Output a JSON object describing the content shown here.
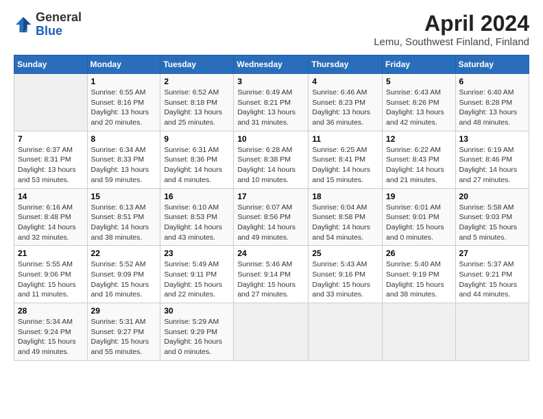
{
  "header": {
    "logo_line1": "General",
    "logo_line2": "Blue",
    "month": "April 2024",
    "location": "Lemu, Southwest Finland, Finland"
  },
  "weekdays": [
    "Sunday",
    "Monday",
    "Tuesday",
    "Wednesday",
    "Thursday",
    "Friday",
    "Saturday"
  ],
  "weeks": [
    [
      {
        "day": "",
        "info": ""
      },
      {
        "day": "1",
        "info": "Sunrise: 6:55 AM\nSunset: 8:16 PM\nDaylight: 13 hours\nand 20 minutes."
      },
      {
        "day": "2",
        "info": "Sunrise: 6:52 AM\nSunset: 8:18 PM\nDaylight: 13 hours\nand 25 minutes."
      },
      {
        "day": "3",
        "info": "Sunrise: 6:49 AM\nSunset: 8:21 PM\nDaylight: 13 hours\nand 31 minutes."
      },
      {
        "day": "4",
        "info": "Sunrise: 6:46 AM\nSunset: 8:23 PM\nDaylight: 13 hours\nand 36 minutes."
      },
      {
        "day": "5",
        "info": "Sunrise: 6:43 AM\nSunset: 8:26 PM\nDaylight: 13 hours\nand 42 minutes."
      },
      {
        "day": "6",
        "info": "Sunrise: 6:40 AM\nSunset: 8:28 PM\nDaylight: 13 hours\nand 48 minutes."
      }
    ],
    [
      {
        "day": "7",
        "info": "Sunrise: 6:37 AM\nSunset: 8:31 PM\nDaylight: 13 hours\nand 53 minutes."
      },
      {
        "day": "8",
        "info": "Sunrise: 6:34 AM\nSunset: 8:33 PM\nDaylight: 13 hours\nand 59 minutes."
      },
      {
        "day": "9",
        "info": "Sunrise: 6:31 AM\nSunset: 8:36 PM\nDaylight: 14 hours\nand 4 minutes."
      },
      {
        "day": "10",
        "info": "Sunrise: 6:28 AM\nSunset: 8:38 PM\nDaylight: 14 hours\nand 10 minutes."
      },
      {
        "day": "11",
        "info": "Sunrise: 6:25 AM\nSunset: 8:41 PM\nDaylight: 14 hours\nand 15 minutes."
      },
      {
        "day": "12",
        "info": "Sunrise: 6:22 AM\nSunset: 8:43 PM\nDaylight: 14 hours\nand 21 minutes."
      },
      {
        "day": "13",
        "info": "Sunrise: 6:19 AM\nSunset: 8:46 PM\nDaylight: 14 hours\nand 27 minutes."
      }
    ],
    [
      {
        "day": "14",
        "info": "Sunrise: 6:16 AM\nSunset: 8:48 PM\nDaylight: 14 hours\nand 32 minutes."
      },
      {
        "day": "15",
        "info": "Sunrise: 6:13 AM\nSunset: 8:51 PM\nDaylight: 14 hours\nand 38 minutes."
      },
      {
        "day": "16",
        "info": "Sunrise: 6:10 AM\nSunset: 8:53 PM\nDaylight: 14 hours\nand 43 minutes."
      },
      {
        "day": "17",
        "info": "Sunrise: 6:07 AM\nSunset: 8:56 PM\nDaylight: 14 hours\nand 49 minutes."
      },
      {
        "day": "18",
        "info": "Sunrise: 6:04 AM\nSunset: 8:58 PM\nDaylight: 14 hours\nand 54 minutes."
      },
      {
        "day": "19",
        "info": "Sunrise: 6:01 AM\nSunset: 9:01 PM\nDaylight: 15 hours\nand 0 minutes."
      },
      {
        "day": "20",
        "info": "Sunrise: 5:58 AM\nSunset: 9:03 PM\nDaylight: 15 hours\nand 5 minutes."
      }
    ],
    [
      {
        "day": "21",
        "info": "Sunrise: 5:55 AM\nSunset: 9:06 PM\nDaylight: 15 hours\nand 11 minutes."
      },
      {
        "day": "22",
        "info": "Sunrise: 5:52 AM\nSunset: 9:09 PM\nDaylight: 15 hours\nand 16 minutes."
      },
      {
        "day": "23",
        "info": "Sunrise: 5:49 AM\nSunset: 9:11 PM\nDaylight: 15 hours\nand 22 minutes."
      },
      {
        "day": "24",
        "info": "Sunrise: 5:46 AM\nSunset: 9:14 PM\nDaylight: 15 hours\nand 27 minutes."
      },
      {
        "day": "25",
        "info": "Sunrise: 5:43 AM\nSunset: 9:16 PM\nDaylight: 15 hours\nand 33 minutes."
      },
      {
        "day": "26",
        "info": "Sunrise: 5:40 AM\nSunset: 9:19 PM\nDaylight: 15 hours\nand 38 minutes."
      },
      {
        "day": "27",
        "info": "Sunrise: 5:37 AM\nSunset: 9:21 PM\nDaylight: 15 hours\nand 44 minutes."
      }
    ],
    [
      {
        "day": "28",
        "info": "Sunrise: 5:34 AM\nSunset: 9:24 PM\nDaylight: 15 hours\nand 49 minutes."
      },
      {
        "day": "29",
        "info": "Sunrise: 5:31 AM\nSunset: 9:27 PM\nDaylight: 15 hours\nand 55 minutes."
      },
      {
        "day": "30",
        "info": "Sunrise: 5:29 AM\nSunset: 9:29 PM\nDaylight: 16 hours\nand 0 minutes."
      },
      {
        "day": "",
        "info": ""
      },
      {
        "day": "",
        "info": ""
      },
      {
        "day": "",
        "info": ""
      },
      {
        "day": "",
        "info": ""
      }
    ]
  ]
}
